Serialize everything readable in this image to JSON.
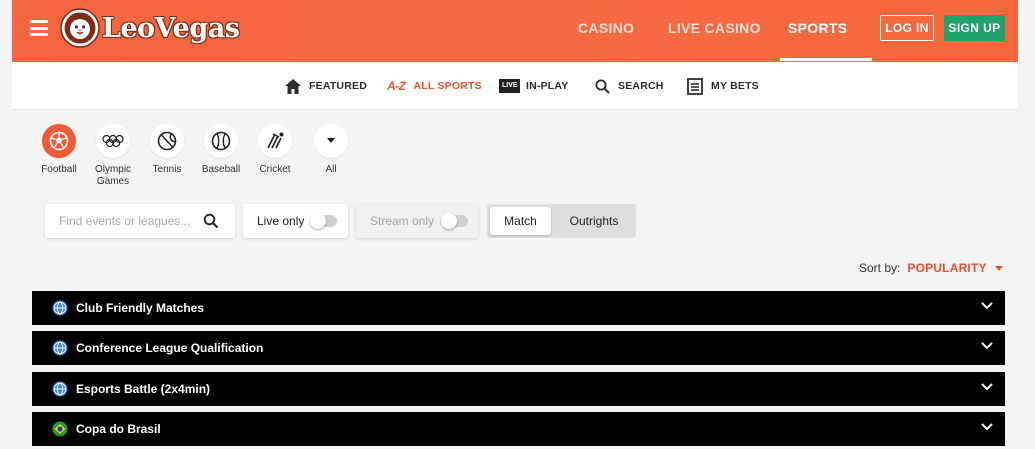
{
  "header": {
    "logo_text": "LeoVegas",
    "nav": [
      {
        "label": "CASINO"
      },
      {
        "label": "LIVE CASINO"
      },
      {
        "label": "SPORTS"
      }
    ],
    "login_label": "LOG IN",
    "signup_label": "SIGN UP"
  },
  "subnav": {
    "items": [
      {
        "label": "FEATURED",
        "icon": "home-icon"
      },
      {
        "label": "ALL SPORTS",
        "icon": "az-icon",
        "az": "A-Z"
      },
      {
        "label": "IN-PLAY",
        "icon": "live-icon",
        "live": "LIVE"
      },
      {
        "label": "SEARCH",
        "icon": "search-icon"
      },
      {
        "label": "MY BETS",
        "icon": "betslip-icon"
      }
    ]
  },
  "sports": [
    {
      "label": "Football",
      "icon": "football-icon"
    },
    {
      "label": "Olympic Games",
      "icon": "olympic-rings-icon"
    },
    {
      "label": "Tennis",
      "icon": "tennis-ball-icon"
    },
    {
      "label": "Baseball",
      "icon": "baseball-icon"
    },
    {
      "label": "Cricket",
      "icon": "cricket-icon"
    },
    {
      "label": "All",
      "icon": "caret-down-icon"
    }
  ],
  "filters": {
    "search_placeholder": "Find events or leagues...",
    "live_only_label": "Live only",
    "stream_only_label": "Stream only",
    "match_label": "Match",
    "outrights_label": "Outrights"
  },
  "sort": {
    "label": "Sort by:",
    "value": "POPULARITY"
  },
  "leagues": [
    {
      "name": "Club Friendly Matches",
      "flag": "globe-icon"
    },
    {
      "name": "Conference League Qualification",
      "flag": "globe-icon"
    },
    {
      "name": "Esports Battle (2x4min)",
      "flag": "globe-icon"
    },
    {
      "name": "Copa do Brasil",
      "flag": "brazil-flag-icon"
    }
  ],
  "colors": {
    "brand_orange": "#f56a43",
    "accent_orange": "#e8512e",
    "signup_green": "#1fa36a"
  }
}
